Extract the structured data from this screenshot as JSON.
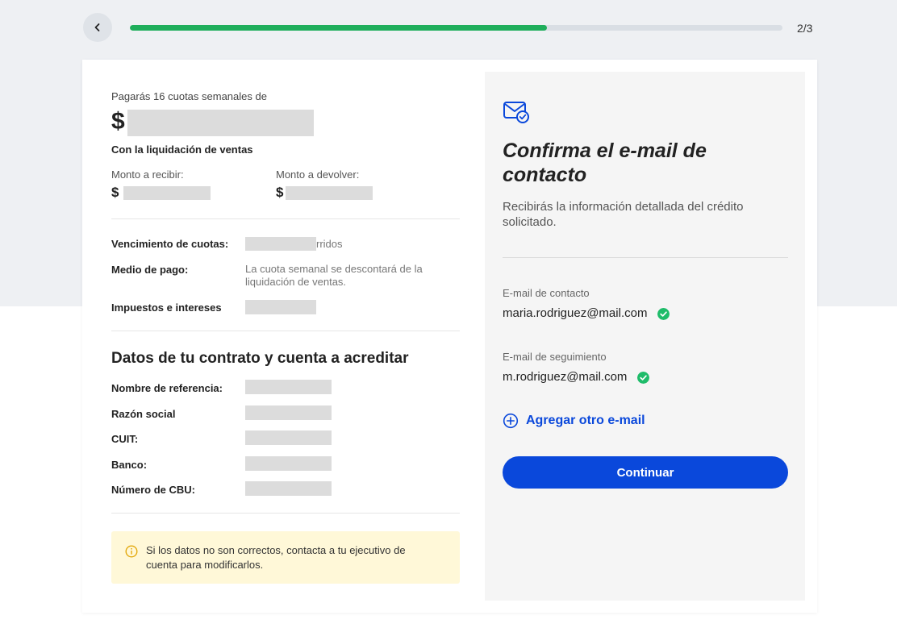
{
  "progress": {
    "step": "2/3",
    "fraction": 0.639
  },
  "summary": {
    "intro": "Pagarás 16 cuotas semanales de",
    "currency": "$",
    "subtitle": "Con la liquidación de ventas",
    "receive_label": "Monto a recibir:",
    "return_label": "Monto a devolver:"
  },
  "details": {
    "due_label": "Vencimiento de cuotas:",
    "due_value_suffix": "rridos",
    "payment_label": "Medio de pago:",
    "payment_value": "La cuota semanal se descontará de la liquidación de ventas.",
    "taxes_label": "Impuestos e intereses"
  },
  "contract": {
    "title": "Datos de tu contrato y cuenta a acreditar",
    "fields": [
      {
        "label": "Nombre de referencia:"
      },
      {
        "label": "Razón social"
      },
      {
        "label": "CUIT:"
      },
      {
        "label": "Banco:"
      },
      {
        "label": "Número de CBU:"
      }
    ]
  },
  "notice": {
    "text": "Si los datos no son correctos, contacta a tu ejecutivo de cuenta para modificarlos.",
    "icon": "info-icon"
  },
  "email_panel": {
    "icon": "mail-check-icon",
    "title": "Confirma el e-mail de contacto",
    "subtitle": "Recibirás la información detallada del crédito solicitado.",
    "contact_label": "E-mail de contacto",
    "contact_value": "maria.rodriguez@mail.com",
    "followup_label": "E-mail de seguimiento",
    "followup_value": "m.rodriguez@mail.com",
    "add_label": "Agregar otro e-mail",
    "continue_label": "Continuar"
  },
  "colors": {
    "progress": "#1fae5b",
    "primary": "#0a48db",
    "check": "#1fbc6a",
    "notice_bg": "#fff8d8"
  }
}
